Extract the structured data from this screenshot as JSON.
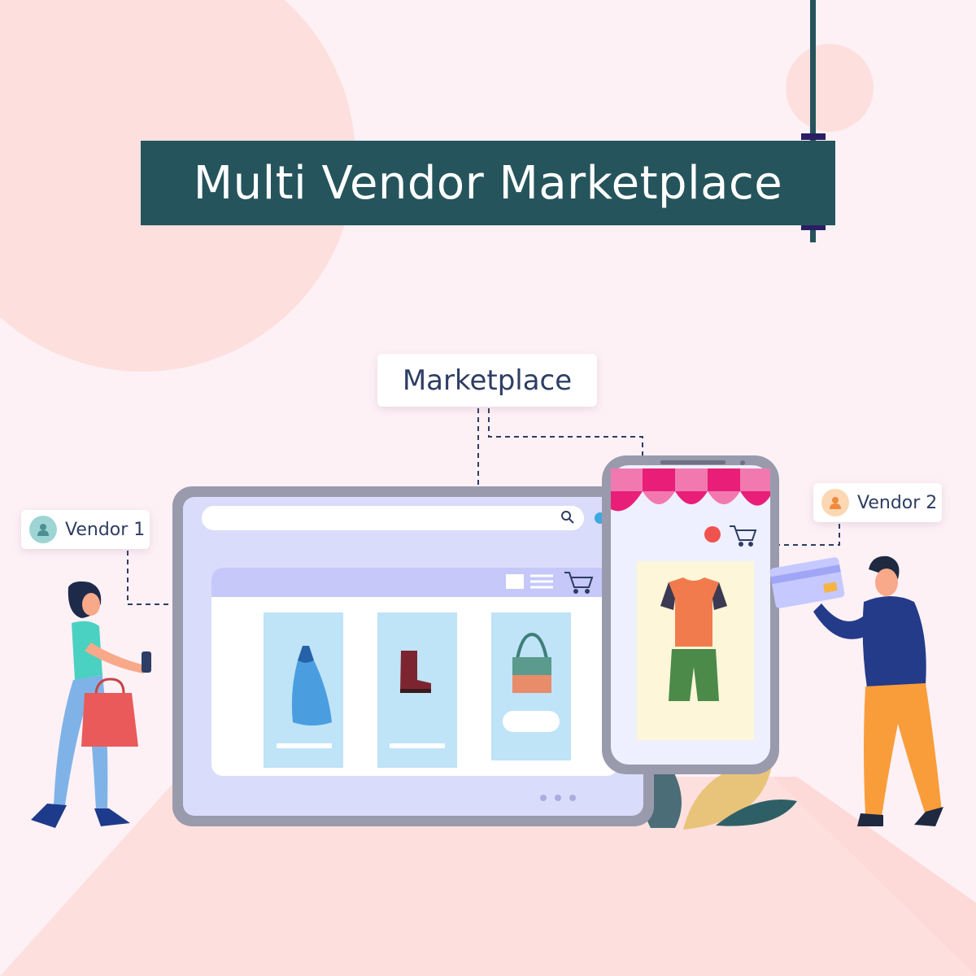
{
  "banner": {
    "title": "Multi Vendor Marketplace"
  },
  "hub": {
    "label": "Marketplace"
  },
  "vendors": [
    {
      "label": "Vendor 1",
      "avatar_color": "#9ed4d4",
      "icon": "user-icon"
    },
    {
      "label": "Vendor 2",
      "avatar_color": "#fbd7b4",
      "icon": "user-icon"
    }
  ],
  "colors": {
    "background": "#fdf1f6",
    "banner": "#25545c",
    "accent_pink": "#e91e78",
    "screen_frame": "#9a9aad",
    "screen_fill": "#dadcfb"
  },
  "icons": {
    "browser": [
      "search-icon",
      "grid-view-icon",
      "list-view-icon",
      "cart-icon"
    ],
    "phone": [
      "notification-dot",
      "cart-icon"
    ],
    "products": [
      "dress-icon",
      "boot-icon",
      "handbag-icon",
      "tshirt-shorts-icon"
    ]
  }
}
